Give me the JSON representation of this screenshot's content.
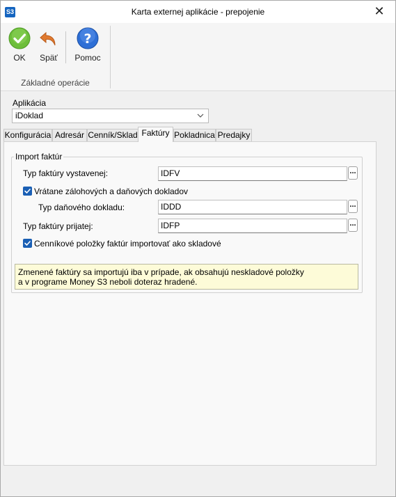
{
  "window": {
    "app_icon": "S3",
    "title": "Karta externej aplikácie - prepojenie",
    "close": "✕"
  },
  "ribbon": {
    "buttons": [
      {
        "label": "OK",
        "icon": "ok-check-icon",
        "color": "#6dbe3a"
      },
      {
        "label": "Späť",
        "icon": "undo-arrow-icon",
        "color": "#e07a2f"
      },
      {
        "label": "Pomoc",
        "icon": "help-question-icon",
        "color": "#2e6fd6"
      }
    ],
    "group_label": "Základné operácie"
  },
  "app": {
    "label": "Aplikácia",
    "selected": "iDoklad"
  },
  "tabs": [
    "Konfigurácia",
    "Adresár",
    "Cenník/Sklad",
    "Faktúry",
    "Pokladnica",
    "Predajky"
  ],
  "active_tab": "Faktúry",
  "import": {
    "legend": "Import faktúr",
    "issued_label": "Typ faktúry vystavenej:",
    "issued_value": "IDFV",
    "include_label": "Vrátane zálohových a daňových dokladov",
    "include_checked": true,
    "tax_label": "Typ daňového dokladu:",
    "tax_value": "IDDD",
    "received_label": "Typ faktúry prijatej:",
    "received_value": "IDFP",
    "stock_label": "Cenníkové položky faktúr importovať ako skladové",
    "stock_checked": true,
    "dots": "..."
  },
  "note": {
    "line1": "Zmenené faktúry sa importujú iba v prípade, ak obsahujú neskladové položky",
    "line2": "a v programe Money S3 neboli doteraz hradené."
  }
}
